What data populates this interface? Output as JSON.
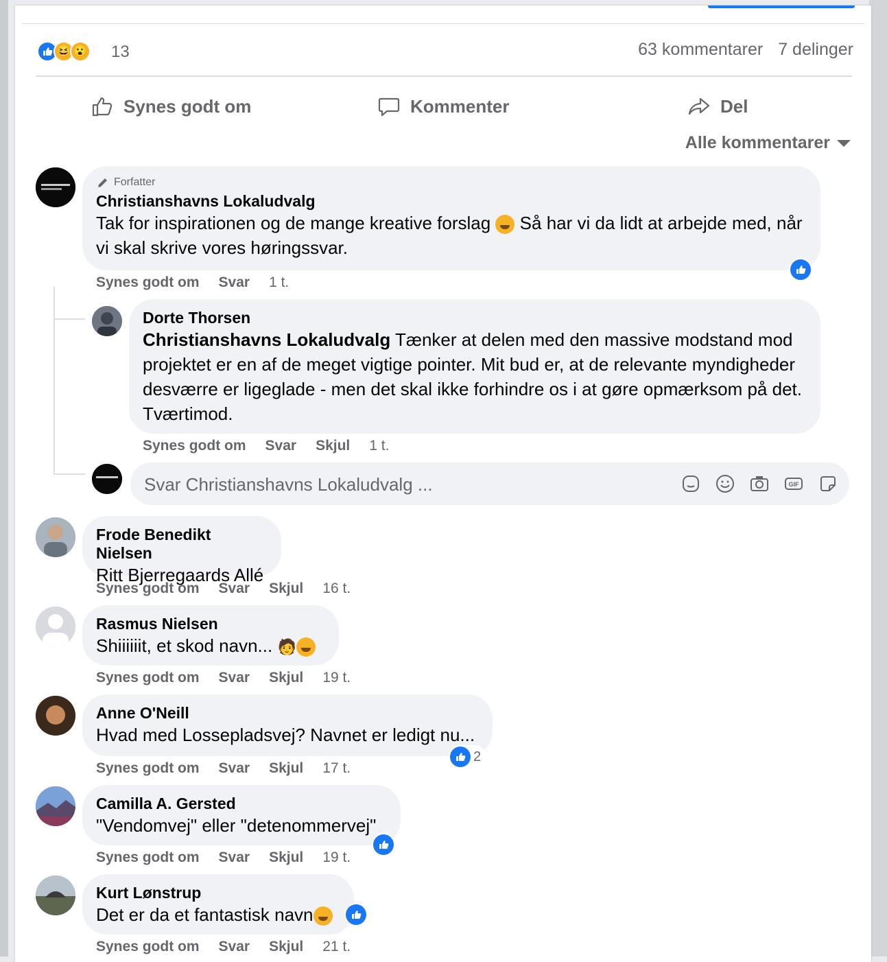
{
  "reactions": {
    "count": "13",
    "types": [
      "like-icon",
      "haha-icon",
      "wow-icon"
    ]
  },
  "stats": {
    "comments": "63 kommentarer",
    "shares": "7 delinger"
  },
  "actions": {
    "like": "Synes godt om",
    "comment": "Kommenter",
    "share": "Del"
  },
  "sort_label": "Alle kommentarer",
  "comments": [
    {
      "badge": "Forfatter",
      "author": "Christianshavns Lokaludvalg",
      "text": "Tak for inspirationen og de mange kreative forslag",
      "text2": " Så har vi da lidt at arbejde med, når vi skal skrive vores høringssvar.",
      "like": "Synes godt om",
      "reply": "Svar",
      "time": "1 t."
    },
    {
      "author": "Dorte Thorsen",
      "mention": "Christianshavns Lokaludvalg",
      "text": " Tænker at delen med den massive modstand mod projektet er en af de meget vigtige pointer. Mit bud er, at de relevante myndigheder desværre er ligeglade - men det skal ikke forhindre os i at gøre opmærksom på det. Tværtimod.",
      "like": "Synes godt om",
      "reply": "Svar",
      "hide": "Skjul",
      "time": "1 t."
    },
    {
      "author": "Frode Benedikt Nielsen",
      "text": "Ritt Bjerregaards Allé",
      "like": "Synes godt om",
      "reply": "Svar",
      "hide": "Skjul",
      "time": "16 t."
    },
    {
      "author": "Rasmus Nielsen",
      "text": "Shiiiiiit, et skod navn...",
      "like": "Synes godt om",
      "reply": "Svar",
      "hide": "Skjul",
      "time": "19 t."
    },
    {
      "author": "Anne O'Neill",
      "text": "Hvad med Lossepladsvej? Navnet er ledigt nu...",
      "like_count": "2",
      "like": "Synes godt om",
      "reply": "Svar",
      "hide": "Skjul",
      "time": "17 t."
    },
    {
      "author": "Camilla A. Gersted",
      "text": "\"Vendomvej\" eller \"detenommervej\"",
      "like": "Synes godt om",
      "reply": "Svar",
      "hide": "Skjul",
      "time": "19 t."
    },
    {
      "author": "Kurt Lønstrup",
      "text": "Det er da et fantastisk navn",
      "like": "Synes godt om",
      "reply": "Svar",
      "hide": "Skjul",
      "time": "21 t."
    }
  ],
  "reply_box": {
    "placeholder": "Svar Christianshavns Lokaludvalg ..."
  },
  "colors": {
    "accent": "#1877f2",
    "bubble": "#f0f2f5",
    "secondary_text": "#65676b"
  }
}
